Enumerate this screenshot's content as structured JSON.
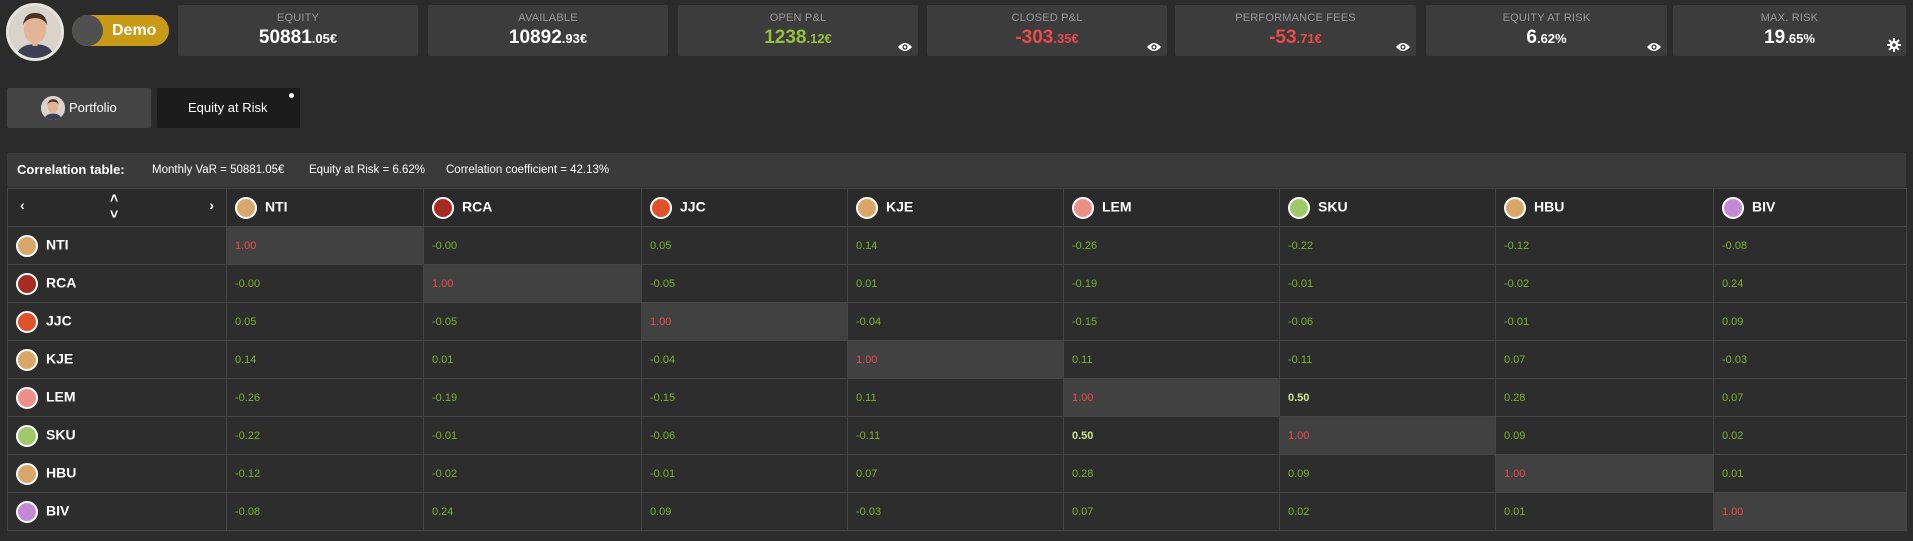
{
  "header": {
    "mode_label": "Demo",
    "stats": [
      {
        "title": "EQUITY",
        "int": "50881",
        "dec": ".05€",
        "tone": "normal",
        "icon": "none"
      },
      {
        "title": "AVAILABLE",
        "int": "10892",
        "dec": ".93€",
        "tone": "normal",
        "icon": "none"
      },
      {
        "title": "OPEN P&L",
        "int": "1238",
        "dec": ".12€",
        "tone": "pos",
        "icon": "eye-icon"
      },
      {
        "title": "CLOSED P&L",
        "int": "-303",
        "dec": ".35€",
        "tone": "neg",
        "icon": "eye-icon"
      },
      {
        "title": "PERFORMANCE FEES",
        "int": "-53",
        "dec": ".71€",
        "tone": "neg",
        "icon": "eye-icon"
      },
      {
        "title": "EQUITY AT RISK",
        "int": "6",
        "dec": ".62%",
        "tone": "normal",
        "icon": "eye-icon"
      },
      {
        "title": "MAX. RISK",
        "int": "19",
        "dec": ".65%",
        "tone": "normal",
        "icon": "gear-icon"
      }
    ]
  },
  "tabs": {
    "portfolio": "Portfolio",
    "equity_at_risk": "Equity at Risk"
  },
  "correlation": {
    "title": "Correlation table:",
    "monthly_var": "Monthly VaR = 50881.05€",
    "equity_at_risk": "Equity at Risk = 6.62%",
    "coefficient": "Correlation coefficient = 42.13%",
    "nav": {
      "left": "‹",
      "right": "›",
      "up": "˄",
      "down": "˅"
    },
    "symbols": [
      {
        "name": "NTI",
        "color": "#d9a868"
      },
      {
        "name": "RCA",
        "color": "#a62b20"
      },
      {
        "name": "JJC",
        "color": "#e0522a"
      },
      {
        "name": "KJE",
        "color": "#d9a868"
      },
      {
        "name": "LEM",
        "color": "#ee8f8a"
      },
      {
        "name": "SKU",
        "color": "#9fc96a"
      },
      {
        "name": "HBU",
        "color": "#d9a868"
      },
      {
        "name": "BIV",
        "color": "#c58ad6"
      }
    ],
    "matrix": [
      [
        "1.00",
        "-0.00",
        "0.05",
        "0.14",
        "-0.26",
        "-0.22",
        "-0.12",
        "-0.08"
      ],
      [
        "-0.00",
        "1.00",
        "-0.05",
        "0.01",
        "-0.19",
        "-0.01",
        "-0.02",
        "0.24"
      ],
      [
        "0.05",
        "-0.05",
        "1.00",
        "-0.04",
        "-0.15",
        "-0.06",
        "-0.01",
        "0.09"
      ],
      [
        "0.14",
        "0.01",
        "-0.04",
        "1.00",
        "0.11",
        "-0.11",
        "0.07",
        "-0.03"
      ],
      [
        "-0.26",
        "-0.19",
        "-0.15",
        "0.11",
        "1.00",
        "0.50",
        "0.28",
        "0.07"
      ],
      [
        "-0.22",
        "-0.01",
        "-0.06",
        "-0.11",
        "0.50",
        "1.00",
        "0.09",
        "0.02"
      ],
      [
        "-0.12",
        "-0.02",
        "-0.01",
        "0.07",
        "0.28",
        "0.09",
        "1.00",
        "0.01"
      ],
      [
        "-0.08",
        "0.24",
        "0.09",
        "-0.03",
        "0.07",
        "0.02",
        "0.01",
        "1.00"
      ]
    ],
    "strong": [
      [
        4,
        5
      ],
      [
        5,
        4
      ]
    ]
  }
}
